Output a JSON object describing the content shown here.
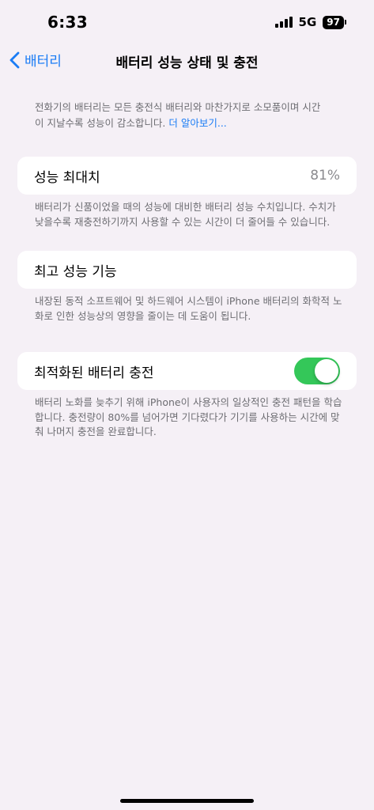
{
  "status_bar": {
    "time": "6:33",
    "network": "5G",
    "battery": "97"
  },
  "nav": {
    "back_label": "배터리",
    "title": "배터리 성능 상태 및 충전"
  },
  "intro": {
    "text": "전화기의 배터리는 모든 충전식 배터리와 마찬가지로 소모품이며 시간이 지날수록 성능이 감소합니다. ",
    "link": "더 알아보기..."
  },
  "max_capacity": {
    "label": "성능 최대치",
    "value": "81%",
    "footer": "배터리가 신품이었을 때의 성능에 대비한 배터리 성능 수치입니다. 수치가 낮을수록 재충전하기까지 사용할 수 있는 시간이 더 줄어들 수 있습니다."
  },
  "peak_performance": {
    "label": "최고 성능 기능",
    "footer": "내장된 동적 소프트웨어 및 하드웨어 시스템이 iPhone 배터리의 화학적 노화로 인한 성능상의 영향을 줄이는 데 도움이 됩니다."
  },
  "optimized_charging": {
    "label": "최적화된 배터리 충전",
    "enabled": true,
    "footer": "배터리 노화를 늦추기 위해 iPhone이 사용자의 일상적인 충전 패턴을 학습합니다. 충전량이 80%를 넘어가면 기다렸다가 기기를 사용하는 시간에 맞춰 나머지 충전을 완료합니다."
  },
  "colors": {
    "accent": "#1a7cf5",
    "toggle_on": "#34c759",
    "background": "#f5f0f6"
  }
}
